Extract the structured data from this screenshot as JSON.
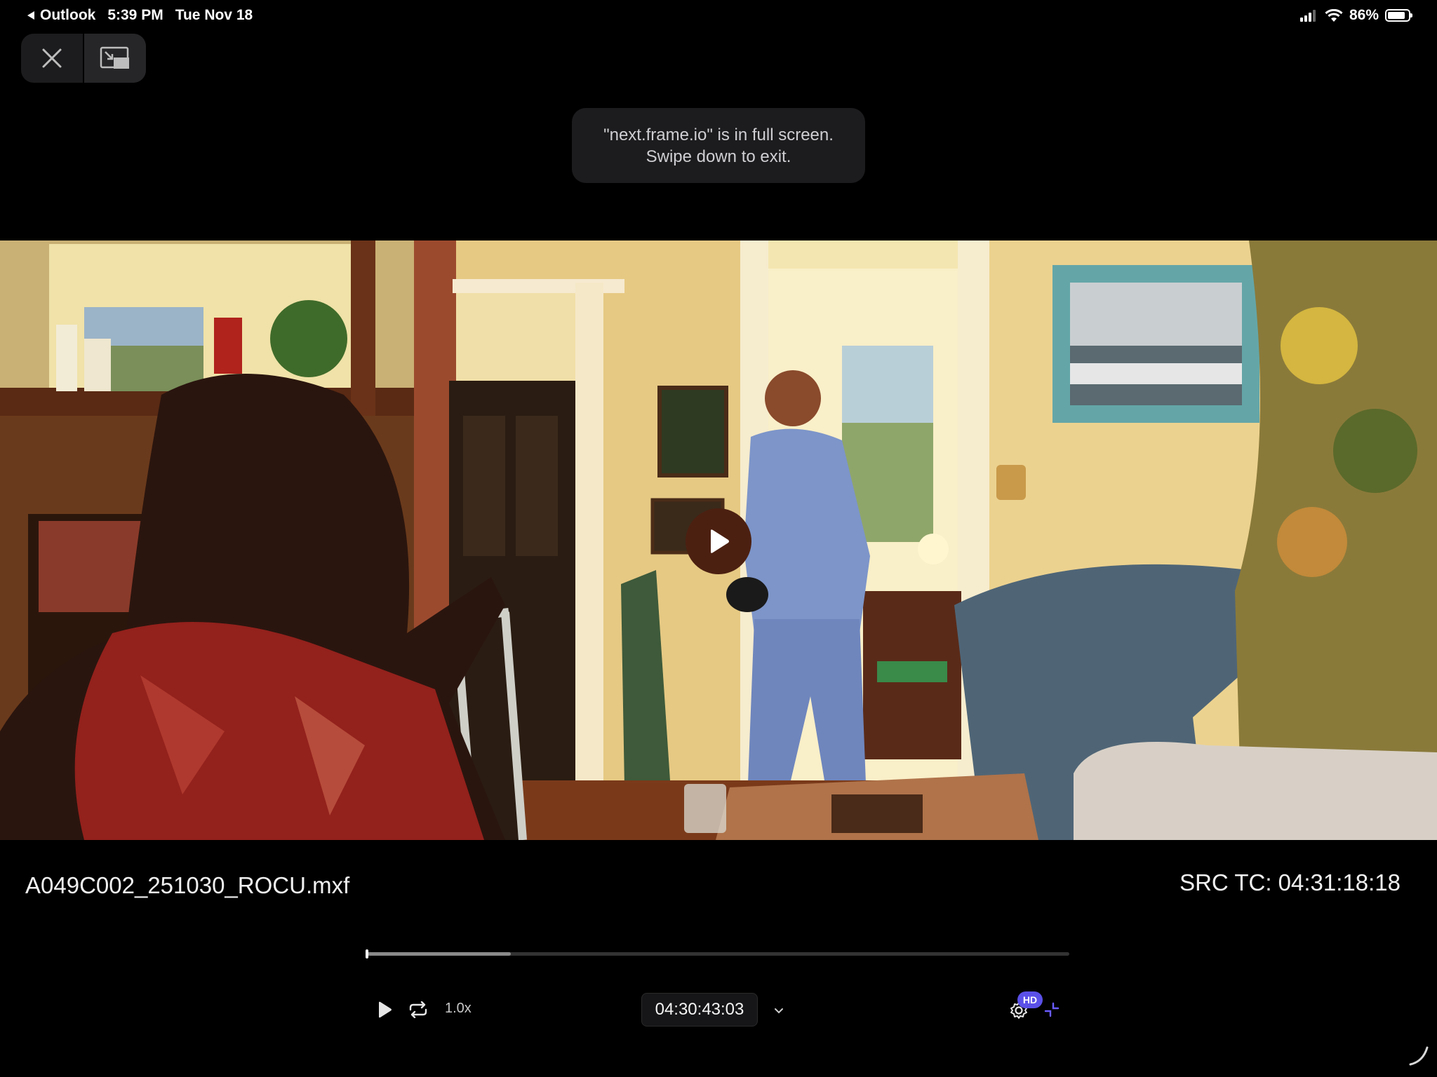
{
  "status_bar": {
    "back_app": "Outlook",
    "time": "5:39 PM",
    "date": "Tue Nov 18",
    "battery_percent": "86%",
    "battery_level": 0.86
  },
  "top_controls": {
    "close_icon": "close-icon",
    "pip_icon": "picture-in-picture-icon"
  },
  "toast": {
    "line1": "\"next.frame.io\" is in full screen.",
    "line2": "Swipe down to exit."
  },
  "player": {
    "filename": "A049C002_251030_ROCU.mxf",
    "src_tc": "SRC TC: 04:31:18:18",
    "speed": "1.0x",
    "timecode": "04:30:43:03",
    "quality_badge": "HD",
    "progress": 0.205
  },
  "colors": {
    "accent": "#5b50e8",
    "play_button": "#4c2011"
  }
}
